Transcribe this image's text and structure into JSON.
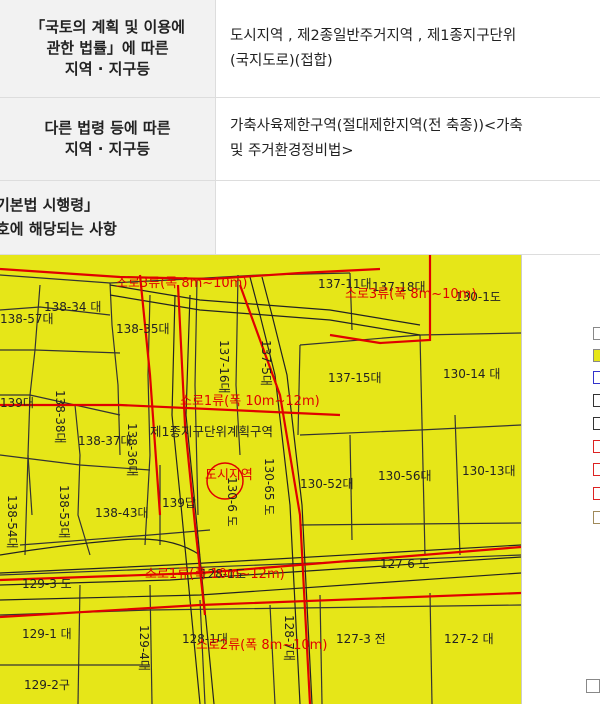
{
  "rows": [
    {
      "head": [
        "「국토의 계획 및 이용에",
        "관한 법률」에 따른",
        "지역 · 지구등"
      ],
      "value": [
        "도시지역 , 제2종일반주거지역 , 제1종지구단위",
        "(국지도로)(접합)"
      ]
    },
    {
      "head": [
        "다른 법령 등에 따른",
        "지역 · 지구등"
      ],
      "value": [
        "가축사육제한구역(절대제한지역(전 축종))<가축",
        "및 주거환경정비법>"
      ]
    },
    {
      "head": [
        "기본법 시행령」",
        "호에 해당되는 사항"
      ],
      "value": []
    }
  ],
  "map": {
    "parcels": [
      "137-11대",
      "137-18대",
      "130-1도",
      "138-57대",
      "138-34 대",
      "138-35대",
      "137-16대",
      "137-5대",
      "137-15대",
      "130-14 대",
      "139대",
      "138-38대",
      "138-37대",
      "138-36대",
      "130-65 도",
      "130-52대",
      "130-56대",
      "130-13대",
      "138-53대",
      "138-54대",
      "138-43대",
      "139답",
      "130-6 도",
      "127-6 도",
      "129-3 도",
      "128-1도",
      "129-1 대",
      "128-1대",
      "128-7대",
      "127-3 전",
      "127-2 대",
      "129-2구",
      "129-4대"
    ],
    "roads": [
      "소로3류(폭 8m~10m)",
      "소로3류(폭 8m~10m)",
      "소로1류(폭 10m~12m)",
      "소로1류(폭 10m~12m)",
      "소로2류(폭 8m~10m)"
    ],
    "zone": "제1종지구단위계획구역",
    "station": "도시지역"
  },
  "legend_colors": [
    "#ffffff",
    "#e6e618",
    "#3333cc",
    "#333333",
    "#333333",
    "#dd2222",
    "#dd2222",
    "#dd2222",
    "#a08a5a"
  ]
}
